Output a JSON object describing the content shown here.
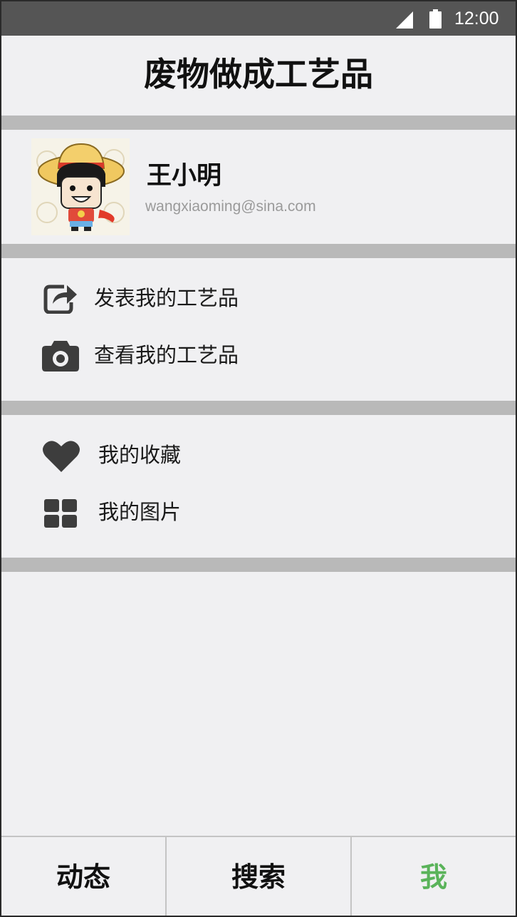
{
  "status_bar": {
    "time": "12:00"
  },
  "header": {
    "title": "废物做成工艺品"
  },
  "profile": {
    "name": "王小明",
    "email": "wangxiaoming@sina.com"
  },
  "menu": {
    "group1": [
      {
        "label": "发表我的工艺品",
        "icon": "share-icon"
      },
      {
        "label": "查看我的工艺品",
        "icon": "camera-icon"
      }
    ],
    "group2": [
      {
        "label": "我的收藏",
        "icon": "heart-icon"
      },
      {
        "label": "我的图片",
        "icon": "grid-icon"
      }
    ]
  },
  "tabs": [
    {
      "label": "动态",
      "active": false
    },
    {
      "label": "搜索",
      "active": false
    },
    {
      "label": "我",
      "active": true
    }
  ],
  "colors": {
    "status_bar": "#555555",
    "background": "#f0f0f2",
    "divider": "#b9b9b9",
    "active_tab": "#5ab35a",
    "icon": "#3d3d3d"
  }
}
